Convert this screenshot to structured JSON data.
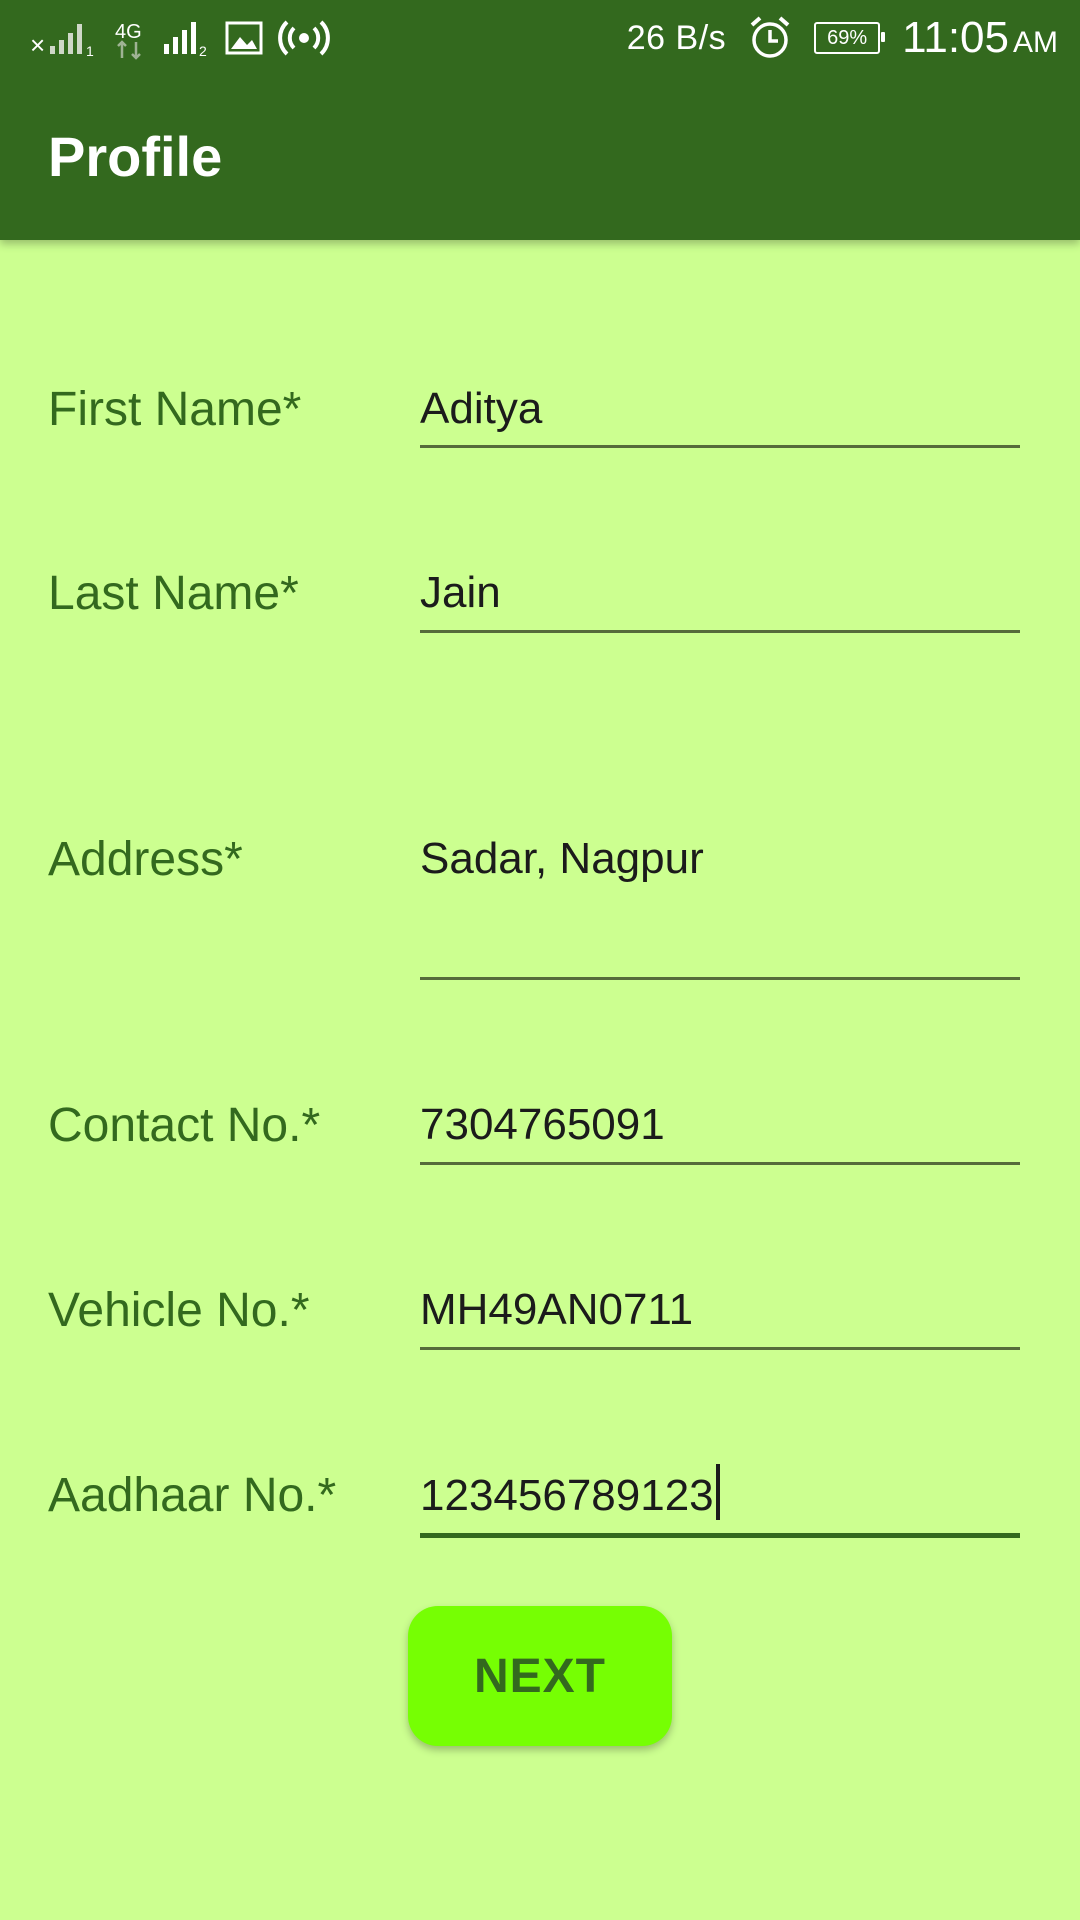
{
  "status_bar": {
    "net_speed": "26 B/s",
    "battery": "69%",
    "time": "11:05",
    "ampm": "AM",
    "icons": [
      "signal-1-icon",
      "4g-icon",
      "signal-2-icon",
      "image-icon",
      "hotspot-icon",
      "alarm-icon",
      "battery-icon"
    ]
  },
  "toolbar": {
    "title": "Profile"
  },
  "form": {
    "first_name": {
      "label": "First Name*",
      "value": "Aditya"
    },
    "last_name": {
      "label": "Last Name*",
      "value": "Jain"
    },
    "address": {
      "label": "Address*",
      "value": "Sadar, Nagpur"
    },
    "contact": {
      "label": "Contact No.*",
      "value": "7304765091"
    },
    "vehicle": {
      "label": "Vehicle No.*",
      "value": "MH49AN0711"
    },
    "aadhaar": {
      "label": "Aadhaar No.*",
      "value": "123456789123"
    }
  },
  "next_button": {
    "label": "NEXT"
  },
  "colors": {
    "primary_dark": "#33691e",
    "background": "#ccff90",
    "accent": "#76ff03"
  }
}
